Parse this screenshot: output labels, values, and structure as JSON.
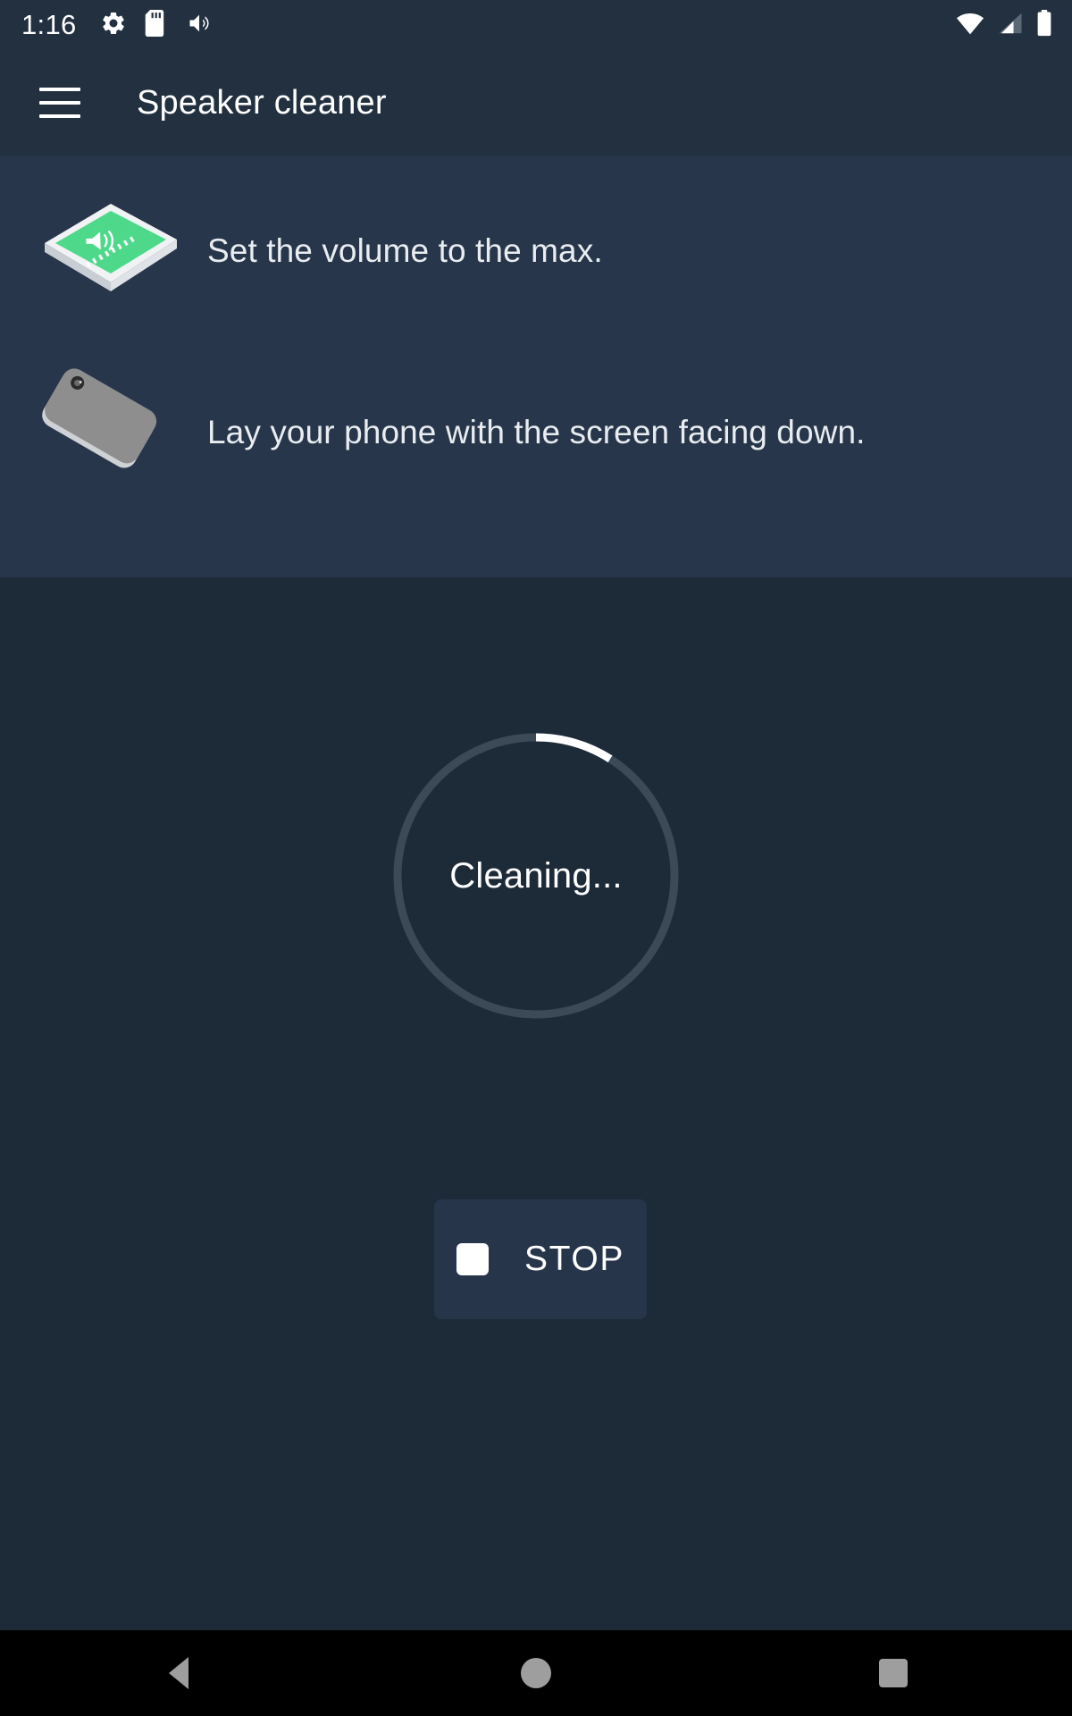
{
  "status_bar": {
    "time": "1:16",
    "left_icons": [
      "settings-gear-icon",
      "sd-card-icon",
      "volume-up-icon"
    ],
    "right_icons": [
      "wifi-icon",
      "cellular-signal-icon",
      "battery-icon"
    ]
  },
  "app_bar": {
    "menu_icon": "hamburger-menu-icon",
    "title": "Speaker cleaner"
  },
  "instructions": [
    {
      "art": "phone-volume-max-illustration",
      "text": "Set the volume to the max."
    },
    {
      "art": "phone-face-down-illustration",
      "text": "Lay your phone with the screen facing down."
    }
  ],
  "progress": {
    "status_text": "Cleaning...",
    "percent": 9,
    "track_color": "#3c4a58",
    "arc_color": "#ffffff"
  },
  "stop_button": {
    "icon": "stop-square-icon",
    "label": "STOP"
  },
  "nav_bar": {
    "back_label": "Back",
    "home_label": "Home",
    "recent_label": "Recent apps"
  },
  "colors": {
    "background": "#1d2a38",
    "panel": "#27364a",
    "app_bar": "#22303f",
    "accent_green": "#4ed98a",
    "nav_bar": "#000000"
  }
}
